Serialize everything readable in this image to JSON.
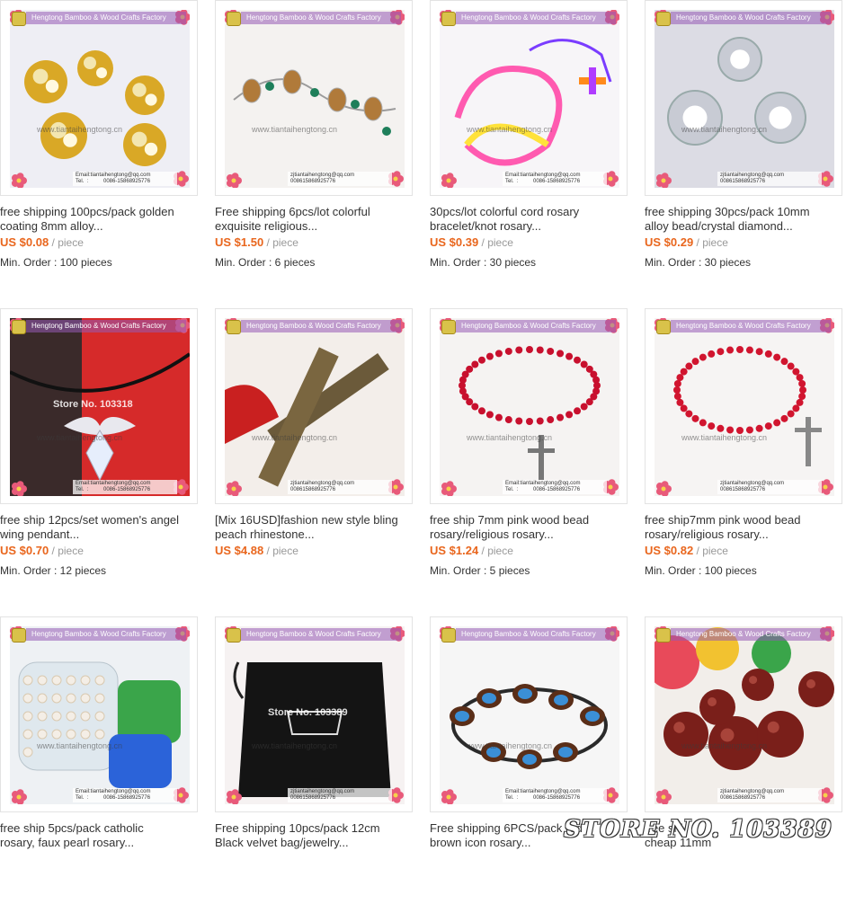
{
  "factory_banner": "Hengtong Bamboo & Wood Crafts Factory",
  "watermark_url": "www.tiantaihengtong.cn",
  "contact": {
    "email": "Email:tiantaihengtong@qq.com",
    "tel": "Tel.  :          0086-15868925776",
    "qq": "zjtiantaihengtong@qq.com",
    "phone": "008615868925776"
  },
  "store_overlay": "STORE NO. 103389",
  "unit_label": "/ piece",
  "colors": {
    "price": "#e9661d",
    "unit": "#999999",
    "border": "#e3e3e3"
  },
  "products": [
    {
      "title": [
        "free shipping 100pcs/pack golden",
        "coating 8mm alloy..."
      ],
      "price": "US $0.08",
      "show_unit": true,
      "min_order": "Min. Order : 100 pieces",
      "image": "gold-rhinestone-balls"
    },
    {
      "title": [
        "Free shipping 6pcs/lot colorful",
        "exquisite religious..."
      ],
      "price": "US $1.50",
      "show_unit": true,
      "min_order": "Min. Order : 6 pieces",
      "image": "religious-bracelet"
    },
    {
      "title": [
        "30pcs/lot colorful cord rosary",
        "bracelet/knot rosary..."
      ],
      "price": "US $0.39",
      "show_unit": true,
      "min_order": "Min. Order : 30 pieces",
      "image": "cord-rosary-bracelet"
    },
    {
      "title": [
        "free shipping 30pcs/pack 10mm",
        "alloy bead/crystal diamond..."
      ],
      "price": "US $0.29",
      "show_unit": true,
      "min_order": "Min. Order : 30 pieces",
      "image": "silver-crystal-beads"
    },
    {
      "title": [
        "free ship 12pcs/set women's angel",
        "wing pendant..."
      ],
      "price": "US $0.70",
      "show_unit": true,
      "min_order": "Min. Order : 12 pieces",
      "image": "angel-wing-pendant",
      "store_wm": "Store No. 103318"
    },
    {
      "title": [
        "[Mix 16USD]fashion new style bling",
        "peach rhinestone..."
      ],
      "price": "US $4.88",
      "show_unit": true,
      "min_order": "",
      "image": "rhinestone-cross"
    },
    {
      "title": [
        "free ship 7mm pink wood bead",
        "rosary/religious rosary..."
      ],
      "price": "US $1.24",
      "show_unit": true,
      "min_order": "Min. Order : 5 pieces",
      "image": "red-rosary-1"
    },
    {
      "title": [
        "free ship7mm pink wood bead",
        "rosary/religious rosary..."
      ],
      "price": "US $0.82",
      "show_unit": true,
      "min_order": "Min. Order : 100 pieces",
      "image": "red-rosary-2"
    },
    {
      "title": [
        "free ship 5pcs/pack catholic",
        "rosary, faux pearl rosary..."
      ],
      "price": "",
      "show_unit": false,
      "min_order": "",
      "image": "pearl-rosary-box"
    },
    {
      "title": [
        "Free shipping 10pcs/pack 12cm",
        "Black velvet bag/jewelry..."
      ],
      "price": "",
      "show_unit": false,
      "min_order": "",
      "image": "velvet-bag",
      "store_wm": "Store No. 103389"
    },
    {
      "title": [
        "Free shipping 6PCS/pack red",
        "brown icon rosary..."
      ],
      "price": "",
      "show_unit": false,
      "min_order": "",
      "image": "icon-bracelet"
    },
    {
      "title": [
        "free shi",
        "cheap 11mm"
      ],
      "price": "",
      "show_unit": false,
      "min_order": "",
      "image": "wood-beads"
    }
  ]
}
